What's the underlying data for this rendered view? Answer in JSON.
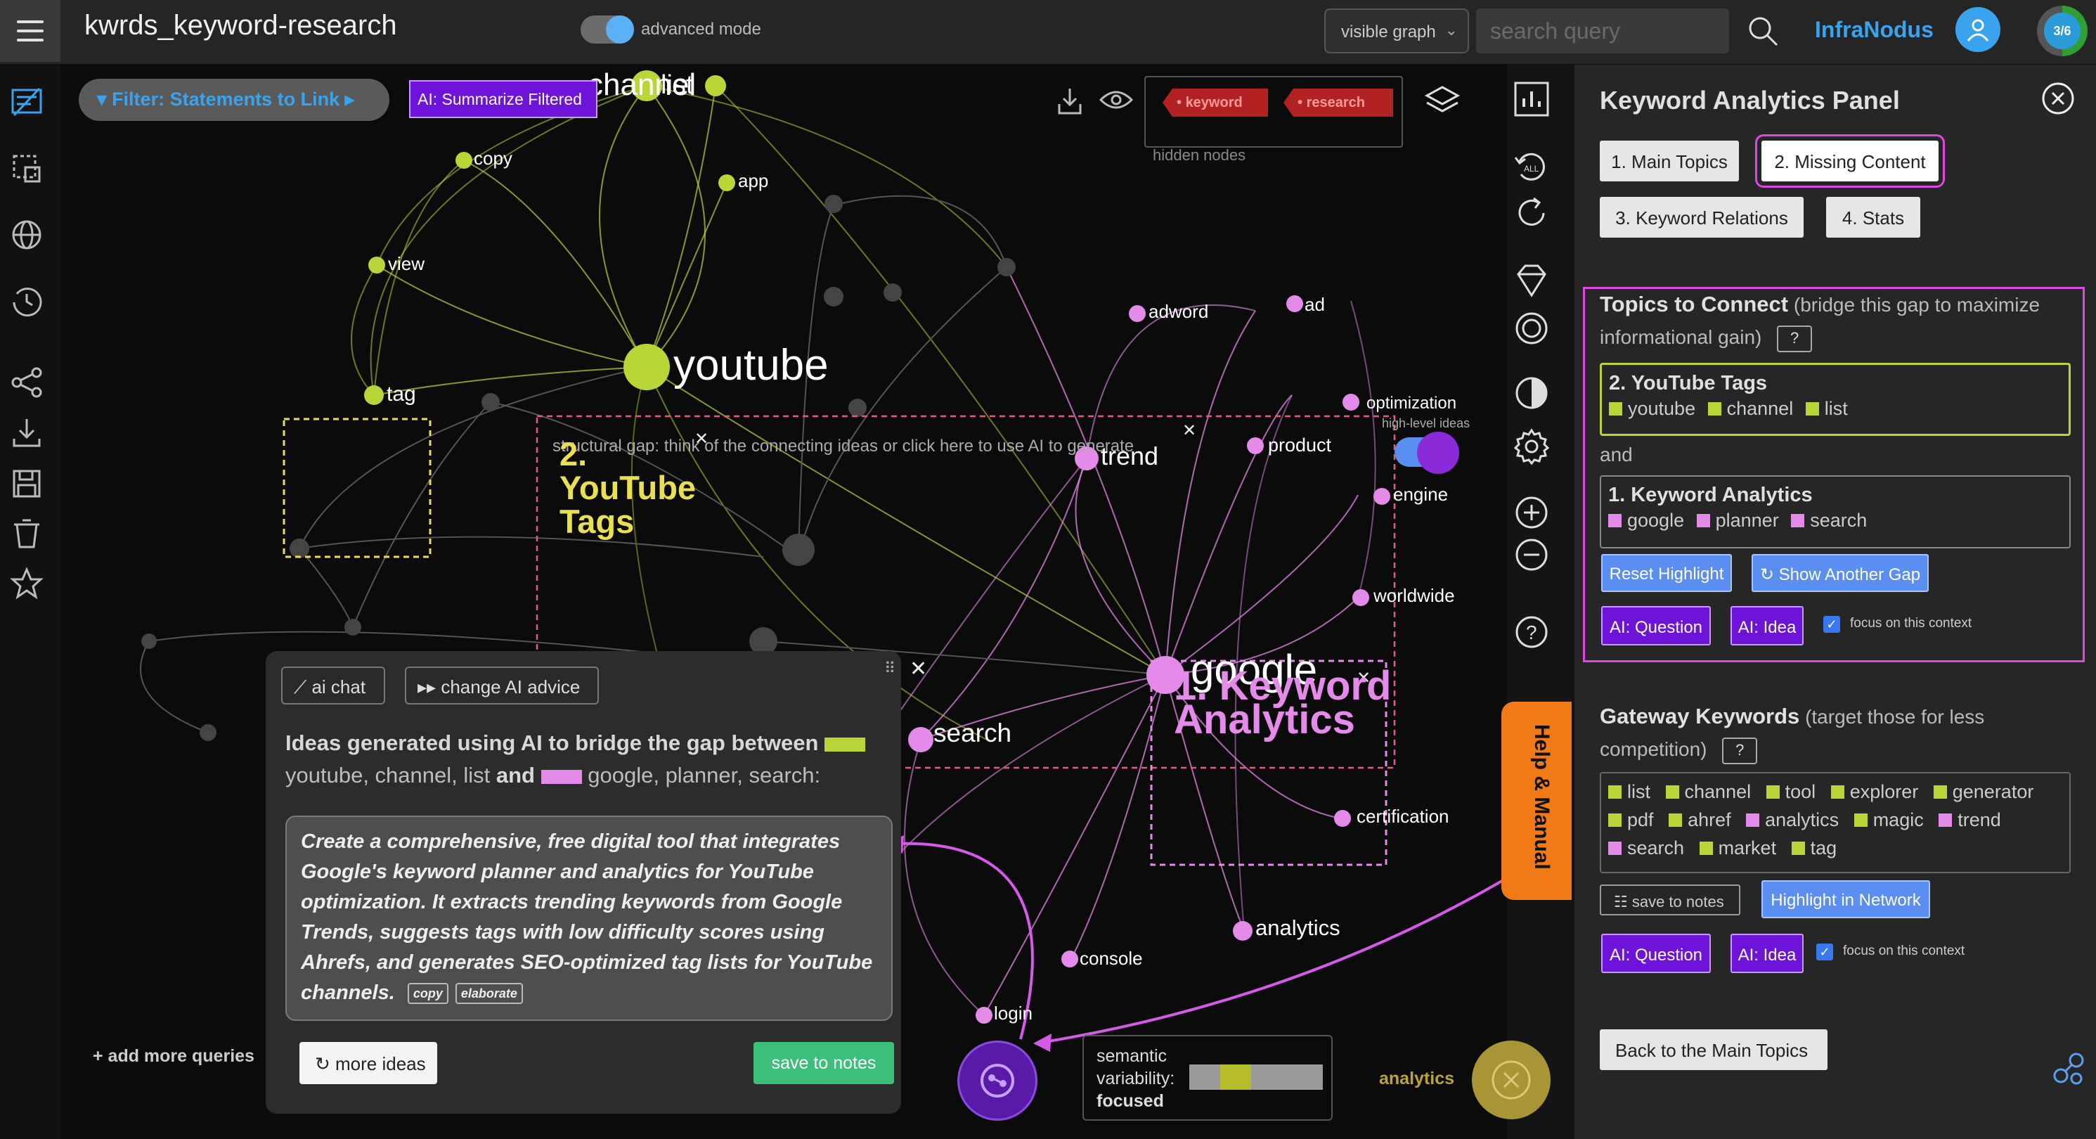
{
  "topbar": {
    "title": "kwrds_keyword-research",
    "advanced_mode_label": "advanced mode",
    "graph_select_value": "visible graph",
    "search_placeholder": "search query",
    "brand": "InfraNodus",
    "progress_label": "3/6"
  },
  "graph": {
    "filter_label": "Filter: Statements to Link",
    "summarize_label": "AI: Summarize Filtered",
    "hidden_nodes": [
      "keyword",
      "research"
    ],
    "hidden_nodes_label": "hidden nodes",
    "nodes": {
      "channel": "channel",
      "list": "list",
      "copy": "copy",
      "app": "app",
      "view": "view",
      "youtube": "youtube",
      "tag": "tag",
      "adword": "adword",
      "ad": "ad",
      "optimization": "optimization",
      "product": "product",
      "trend": "trend",
      "engine": "engine",
      "worldwide": "worldwide",
      "google": "google",
      "search": "search",
      "certification": "certification",
      "analytics": "analytics",
      "console": "console",
      "login": "login"
    },
    "high_level_ideas_label": "high-level ideas",
    "gap_hint": "structural gap: think of the connecting ideas or click here to use AI to generate",
    "cluster_youtube_label": "2. YouTube Tags",
    "cluster_keyword_label": "1. Keyword Analytics",
    "add_more_queries": "+ add more queries",
    "semantic_label_1": "semantic",
    "semantic_label_2": "variability:",
    "semantic_value": "focused",
    "bottom_analytics": "analytics",
    "help_tab": "Help & Manual"
  },
  "ai_popup": {
    "ai_chat_label": "ai chat",
    "change_advice_label": "change AI advice",
    "heading_part1": "Ideas generated using AI to bridge the gap between",
    "heading_part2": "youtube, channel, list",
    "heading_and": "and",
    "heading_part3": "google, planner, search:",
    "idea_text": "Create a comprehensive, free digital tool that integrates Google's keyword planner and analytics for YouTube optimization. It extracts trending keywords from Google Trends, suggests tags with low difficulty scores using Ahrefs, and generates SEO-optimized tag lists for YouTube channels.",
    "copy_label": "copy",
    "elaborate_label": "elaborate",
    "more_ideas_label": "more ideas",
    "save_to_notes_label": "save to notes"
  },
  "panel": {
    "title": "Keyword Analytics Panel",
    "tabs": [
      "1. Main Topics",
      "2. Missing Content",
      "3. Keyword Relations",
      "4. Stats"
    ],
    "topics_heading": "Topics to Connect",
    "topics_sub1": "(bridge this gap to maximize",
    "topics_sub2": "informational gain)",
    "help_q": "?",
    "topic_a_title": "2. YouTube Tags",
    "topic_a_words": [
      "youtube",
      "channel",
      "list"
    ],
    "and_label": "and",
    "topic_b_title": "1. Keyword Analytics",
    "topic_b_words": [
      "google",
      "planner",
      "search"
    ],
    "reset_highlight": "Reset Highlight",
    "show_another_gap": "Show Another Gap",
    "ai_question": "AI: Question",
    "ai_idea": "AI: Idea",
    "focus_context": "focus on this context",
    "gateway_heading": "Gateway Keywords",
    "gateway_sub1": "(target those for less",
    "gateway_sub2": "competition)",
    "gateway_keywords": [
      {
        "word": "list",
        "color": "green"
      },
      {
        "word": "channel",
        "color": "green"
      },
      {
        "word": "tool",
        "color": "green"
      },
      {
        "word": "explorer",
        "color": "green"
      },
      {
        "word": "generator",
        "color": "green"
      },
      {
        "word": "pdf",
        "color": "green"
      },
      {
        "word": "ahref",
        "color": "green"
      },
      {
        "word": "analytics",
        "color": "magenta"
      },
      {
        "word": "magic",
        "color": "green"
      },
      {
        "word": "trend",
        "color": "magenta"
      },
      {
        "word": "search",
        "color": "magenta"
      },
      {
        "word": "market",
        "color": "green"
      },
      {
        "word": "tag",
        "color": "green"
      }
    ],
    "save_to_notes": "save to notes",
    "highlight_network": "Highlight in Network",
    "back_main_topics": "Back to the Main Topics"
  },
  "colors": {
    "green_cluster": "#b8d637",
    "magenta_cluster": "#e48ae8",
    "accent_blue": "#3aa3ee",
    "ai_purple": "#6d14d8",
    "highlight_pink": "#e046e0",
    "help_orange": "#f07a16"
  }
}
